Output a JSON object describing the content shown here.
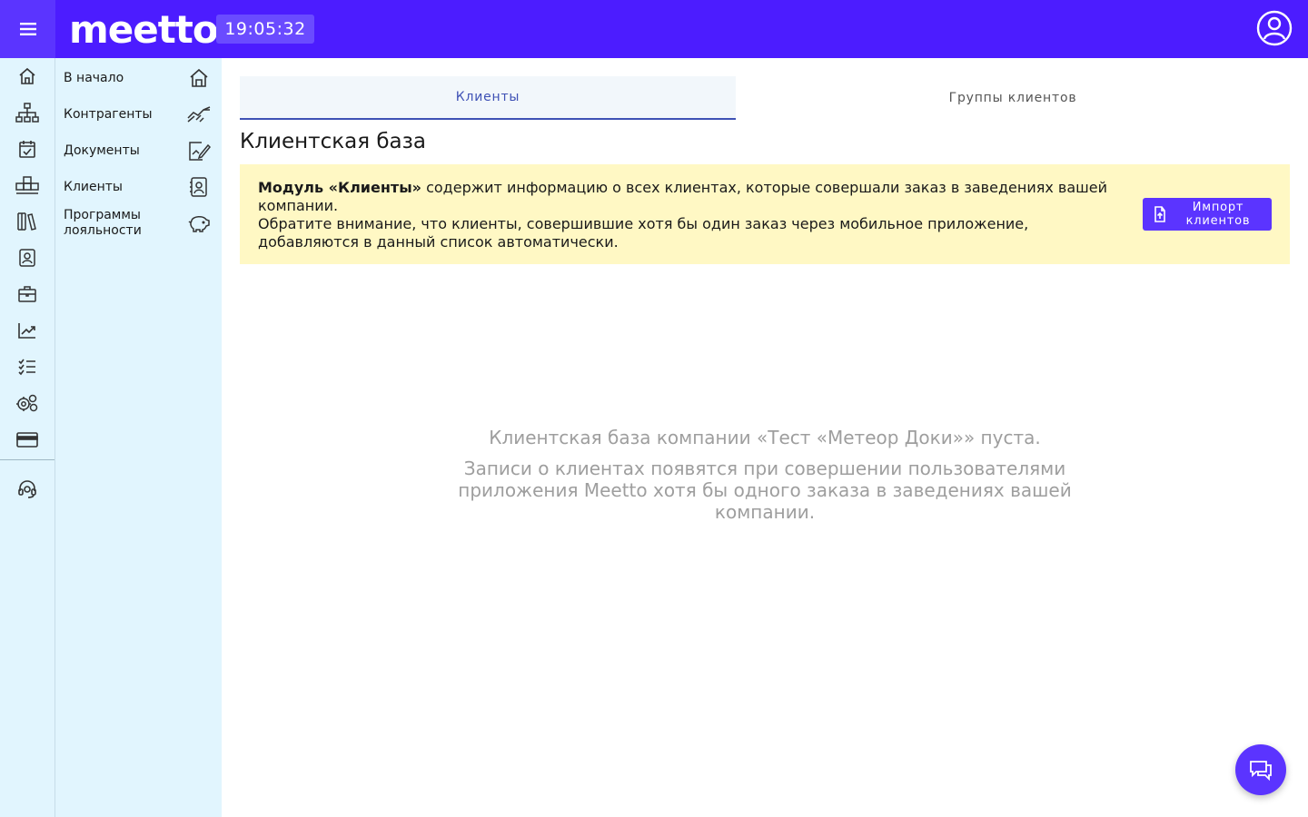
{
  "header": {
    "logo_text": "meetto",
    "clock": "19:05:32",
    "brand_color": "#4c1cff",
    "icons": {
      "menu": "hamburger-icon",
      "user": "user-circle-icon"
    }
  },
  "rail": {
    "items": [
      {
        "icon": "home-icon"
      },
      {
        "icon": "org-structure-icon"
      },
      {
        "icon": "calendar-check-icon"
      },
      {
        "icon": "warehouse-boxes-icon"
      },
      {
        "icon": "library-books-icon"
      },
      {
        "icon": "contact-card-icon"
      },
      {
        "icon": "briefcase-icon"
      },
      {
        "icon": "chart-up-icon"
      },
      {
        "icon": "checklist-icon"
      },
      {
        "icon": "settings-gears-icon"
      },
      {
        "icon": "credit-card-icon"
      },
      {
        "icon": "support-headset-icon"
      }
    ]
  },
  "submenu": {
    "items": [
      {
        "label": "В начало",
        "icon": "home-icon"
      },
      {
        "label": "Контрагенты",
        "icon": "handshake-icon"
      },
      {
        "label": "Документы",
        "icon": "document-edit-icon"
      },
      {
        "label": "Клиенты",
        "icon": "contact-card-icon"
      },
      {
        "label": "Программы лояльности",
        "icon": "piggy-bank-icon"
      }
    ]
  },
  "main": {
    "tabs": [
      {
        "label": "Клиенты",
        "active": true
      },
      {
        "label": "Группы клиентов",
        "active": false
      }
    ],
    "title": "Клиентская база",
    "notice": {
      "bold": "Модуль «Клиенты»",
      "text1": " содержит информацию о всех клиентах, которые совершали заказ в заведениях вашей компании.",
      "text2": "Обратите внимание, что клиенты, совершившие хотя бы один заказ через мобильное приложение, добавляются в данный список автоматически.",
      "background": "#fff8c4"
    },
    "import_button": {
      "label": "Импорт клиентов",
      "icon": "file-import-icon"
    },
    "empty": {
      "line1": "Клиентская база компании «Тест «Метеор Доки»» пуста.",
      "line2": "Записи о клиентах появятся при совершении пользователями приложения Meetto хотя бы одного заказа в заведениях вашей компании."
    }
  },
  "chat": {
    "icon": "chat-bubbles-icon"
  }
}
